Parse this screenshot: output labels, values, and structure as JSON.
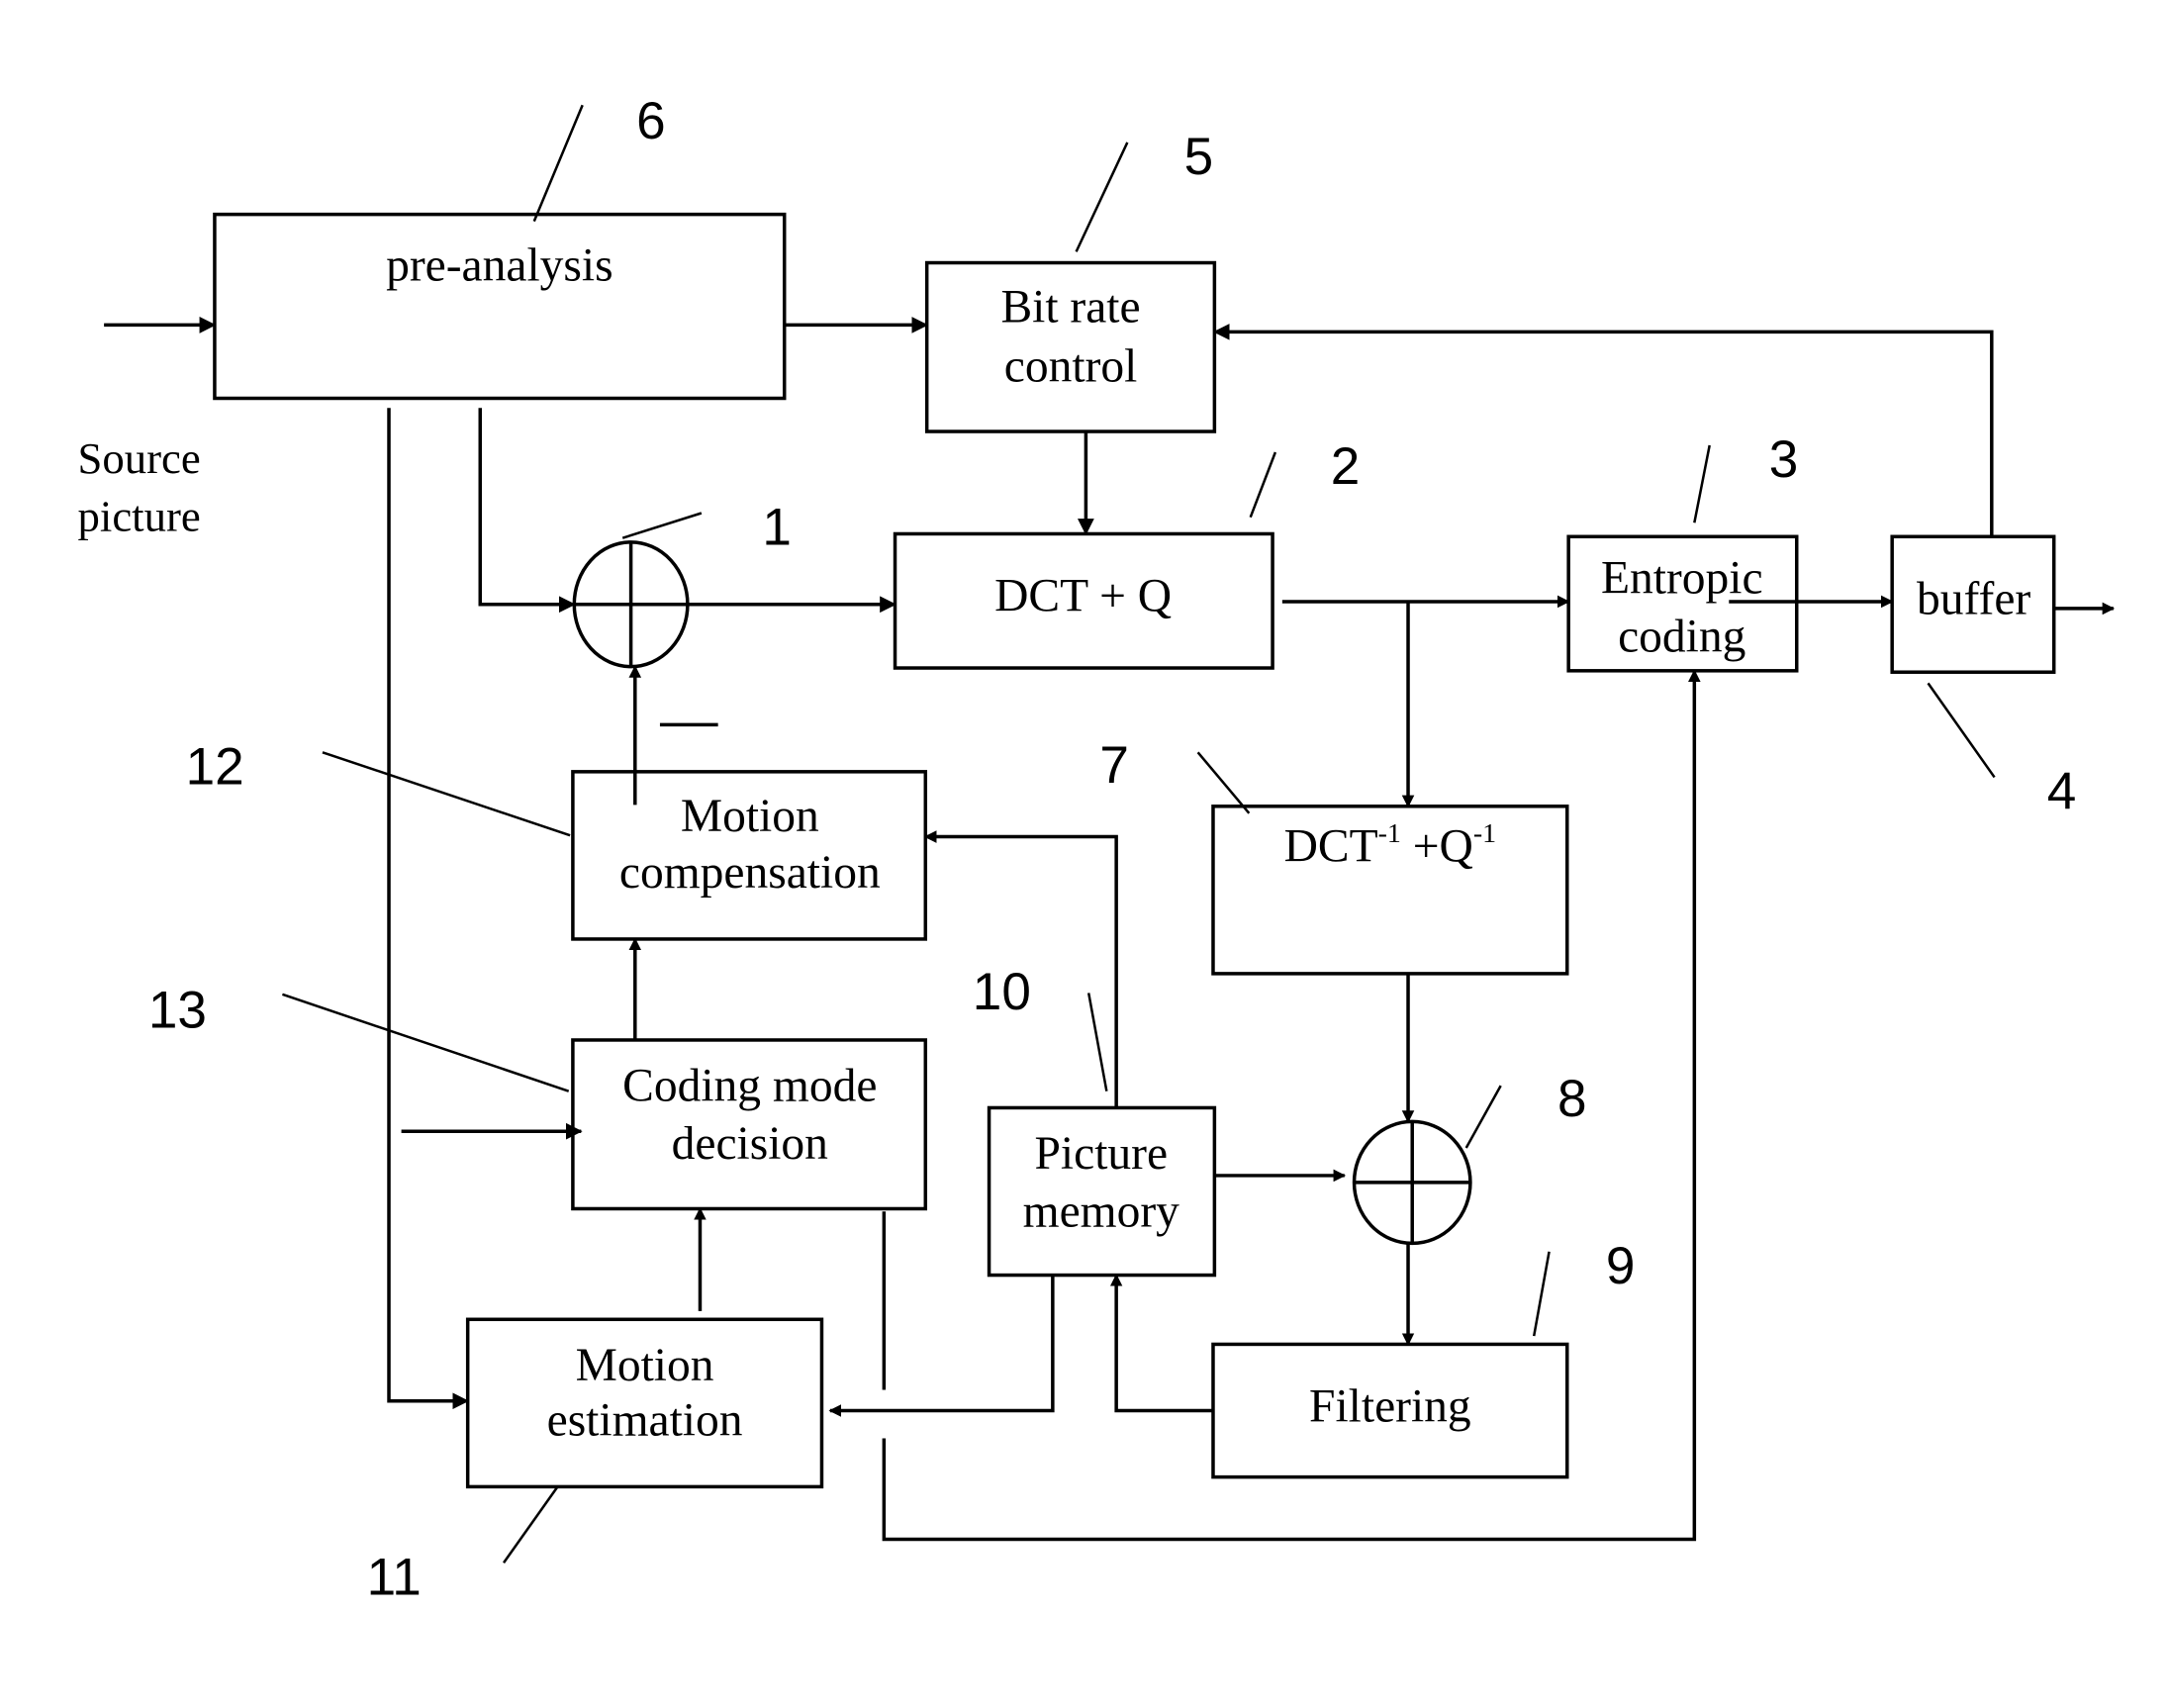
{
  "diagram": {
    "blocks": {
      "pre_analysis": "pre-analysis",
      "bit_rate_control": [
        "Bit rate",
        "control"
      ],
      "dct_q": "DCT + Q",
      "entropic_coding": [
        "Entropic",
        "coding"
      ],
      "buffer": "buffer",
      "inverse_dct_q": {
        "base": "DCT",
        "sup1": "-1",
        "mid": " +Q",
        "sup2": "-1"
      },
      "picture_memory": [
        "Picture",
        "memory"
      ],
      "filtering": "Filtering",
      "motion_compensation": [
        "Motion",
        "compensation"
      ],
      "coding_mode_decision": [
        "Coding mode",
        "decision"
      ],
      "motion_estimation": [
        "Motion",
        "estimation"
      ]
    },
    "input_label": [
      "Source",
      "picture"
    ],
    "minus_sign": "—",
    "reference_numbers": {
      "adder": "1",
      "dct_q": "2",
      "entropic_coding": "3",
      "buffer": "4",
      "bit_rate_control": "5",
      "pre_analysis": "6",
      "inverse_dct_q": "7",
      "adder2": "8",
      "filtering": "9",
      "picture_memory": "10",
      "motion_estimation": "11",
      "motion_compensation": "12",
      "coding_mode_decision": "13"
    }
  }
}
